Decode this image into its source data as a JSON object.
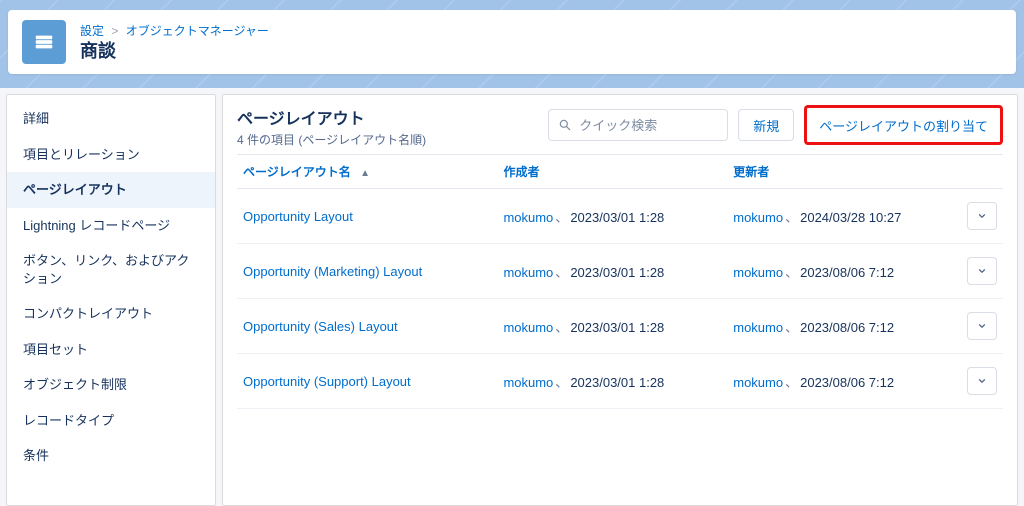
{
  "breadcrumb": {
    "setup": "設定",
    "object_manager": "オブジェクトマネージャー"
  },
  "page_title": "商談",
  "sidebar": {
    "items": [
      {
        "label": "詳細"
      },
      {
        "label": "項目とリレーション"
      },
      {
        "label": "ページレイアウト"
      },
      {
        "label": "Lightning レコードページ"
      },
      {
        "label": "ボタン、リンク、およびアクション"
      },
      {
        "label": "コンパクトレイアウト"
      },
      {
        "label": "項目セット"
      },
      {
        "label": "オブジェクト制限"
      },
      {
        "label": "レコードタイプ"
      },
      {
        "label": "条件"
      }
    ],
    "active_index": 2
  },
  "main": {
    "title": "ページレイアウト",
    "subtitle": "4 件の項目 (ページレイアウト名順)",
    "search_placeholder": "クイック検索",
    "new_button": "新規",
    "assign_button": "ページレイアウトの割り当て"
  },
  "table": {
    "headers": {
      "name": "ページレイアウト名",
      "creator": "作成者",
      "updater": "更新者"
    },
    "rows": [
      {
        "name": "Opportunity Layout",
        "creator_user": "mokumo",
        "creator_date": "2023/03/01 1:28",
        "updater_user": "mokumo",
        "updater_date": "2024/03/28 10:27"
      },
      {
        "name": "Opportunity (Marketing) Layout",
        "creator_user": "mokumo",
        "creator_date": "2023/03/01 1:28",
        "updater_user": "mokumo",
        "updater_date": "2023/08/06 7:12"
      },
      {
        "name": "Opportunity (Sales) Layout",
        "creator_user": "mokumo",
        "creator_date": "2023/03/01 1:28",
        "updater_user": "mokumo",
        "updater_date": "2023/08/06 7:12"
      },
      {
        "name": "Opportunity (Support) Layout",
        "creator_user": "mokumo",
        "creator_date": "2023/03/01 1:28",
        "updater_user": "mokumo",
        "updater_date": "2023/08/06 7:12"
      }
    ],
    "user_sep": "、"
  }
}
